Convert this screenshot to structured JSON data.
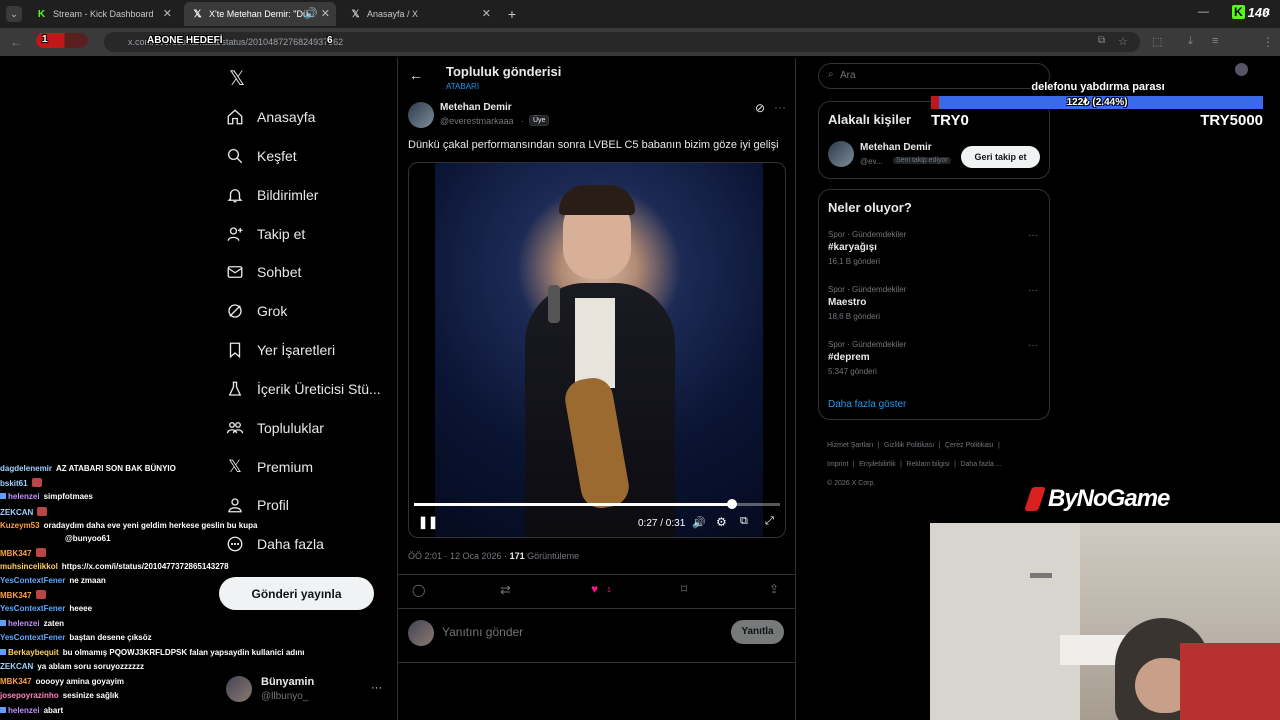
{
  "browser": {
    "tabs": [
      {
        "title": "Stream - Kick Dashboard",
        "active": false
      },
      {
        "title": "X'te Metehan Demir: \"Dünk",
        "active": true
      },
      {
        "title": "Anasayfa / X",
        "active": false
      }
    ],
    "url": "x.com/everestmarkaaa/status/2010487276824937562",
    "new_tab": "+"
  },
  "overlay": {
    "goal_count": "1",
    "goal_label": "ABONE HEDEFİ",
    "goal_target": "6",
    "kick_count": "140",
    "donation_title": "delefonu yabdırma parası",
    "donation_progress_text": "122₺ (2.44%)",
    "donation_progress": 0.0244,
    "donation_min": "TRY0",
    "donation_max": "TRY5000",
    "brand": "ByNoGame"
  },
  "x": {
    "nav": [
      {
        "label": "Anasayfa",
        "icon": "home-icon"
      },
      {
        "label": "Keşfet",
        "icon": "search-icon"
      },
      {
        "label": "Bildirimler",
        "icon": "bell-icon"
      },
      {
        "label": "Takip et",
        "icon": "person-add-icon"
      },
      {
        "label": "Sohbet",
        "icon": "mail-icon"
      },
      {
        "label": "Grok",
        "icon": "grok-icon"
      },
      {
        "label": "Yer İşaretleri",
        "icon": "bookmark-icon"
      },
      {
        "label": "İçerik Üreticisi Stü...",
        "icon": "flask-icon"
      },
      {
        "label": "Topluluklar",
        "icon": "communities-icon"
      },
      {
        "label": "Premium",
        "icon": "x-logo-icon"
      },
      {
        "label": "Profil",
        "icon": "person-icon"
      },
      {
        "label": "Daha fazla",
        "icon": "more-circle-icon"
      }
    ],
    "post_button": "Gönderi yayınla",
    "account": {
      "name": "Bünyamin",
      "handle": "@llbunyo_",
      "more": "···"
    },
    "header": {
      "title": "Topluluk gönderisi",
      "subtitle": "ATABARI"
    },
    "post": {
      "author": "Metehan Demir",
      "handle": "@everestmarkaaa",
      "sep": "·",
      "badge": "Üye",
      "text": "Dünkü çakal performansından sonra LVBEL C5 babanın bizim göze iyi gelişi",
      "video_time": "0:27 / 0:31",
      "video_progress": 0.87,
      "timestamp": "ÖÖ 2:01 · 12 Oca 2026 ·",
      "views_count": "171",
      "views_label": "Görüntüleme",
      "like_count": "1"
    },
    "reply": {
      "placeholder": "Yanıtını gönder",
      "button": "Yanıtla"
    },
    "search_placeholder": "Ara",
    "who_to_follow": {
      "title": "Alakalı kişiler",
      "name": "Metehan Demir",
      "handle": "@ev...",
      "badge": "Seni takip ediyor",
      "button": "Geri takip et"
    },
    "trends": {
      "title": "Neler oluyor?",
      "items": [
        {
          "category": "Spor · Gündemdekiler",
          "name": "#karyağışı",
          "count": "16,1 B gönderi"
        },
        {
          "category": "Spor · Gündemdekiler",
          "name": "Maestro",
          "count": "18,6 B gönderi"
        },
        {
          "category": "Spor · Gündemdekiler",
          "name": "#deprem",
          "count": "5.347 gönderi"
        }
      ],
      "more": "Daha fazla göster"
    },
    "footer": {
      "links": [
        "Hizmet Şartları",
        "Gizlilik Politikası",
        "Çerez Politikası",
        "Imprint",
        "Erişilebilirlik",
        "Reklam bilgisi",
        "Daha fazla ..."
      ],
      "copyright": "© 2026 X Corp."
    }
  },
  "chat": [
    {
      "user": "dagdelenemir",
      "msg": "AZ ATABARI SON BAK BÜNYIO",
      "color": "#9fd0ff"
    },
    {
      "user": "bskit61",
      "msg": "",
      "color": "#9fd0ff",
      "emote": true
    },
    {
      "user": "helenzei",
      "msg": "simpfotmaes",
      "color": "#c090ff",
      "badges": true
    },
    {
      "user": "ZEKCAN",
      "msg": "",
      "color": "#9fd0ff",
      "emote": true
    },
    {
      "user": "Kuzeym53",
      "msg": "oradaydım daha eve yeni geldim herkese geslin bu kupa",
      "color": "#ffa040"
    },
    {
      "user": "",
      "msg": "@bunyoo61",
      "color": "#ffffff"
    },
    {
      "user": "MBK347",
      "msg": "",
      "color": "#ffa040",
      "emote": true
    },
    {
      "user": "muhsincelikkol",
      "msg": "https://x.com/i/status/2010477372865143278",
      "color": "#ffd060"
    },
    {
      "user": "YesContextFener",
      "msg": "ne zmaan",
      "color": "#5fa8ff"
    },
    {
      "user": "MBK347",
      "msg": "",
      "color": "#ffa040",
      "emote": true
    },
    {
      "user": "YesContextFener",
      "msg": "heeee",
      "color": "#5fa8ff"
    },
    {
      "user": "helenzei",
      "msg": "zaten",
      "color": "#c090ff",
      "badges": true
    },
    {
      "user": "YesContextFener",
      "msg": "baştan desene çıksöz",
      "color": "#5fa8ff"
    },
    {
      "user": "Berkaybequit",
      "msg": "bu olmamış PQOWJ3KRFLDPSK falan yapsaydin kullanici adını",
      "color": "#ffd060",
      "badges": true
    },
    {
      "user": "ZEKCAN",
      "msg": "ya ablam soru soruyozzzzzz",
      "color": "#9fd0ff"
    },
    {
      "user": "MBK347",
      "msg": "ooooyy amina goyayim",
      "color": "#ffa040"
    },
    {
      "user": "josepoyrazinho",
      "msg": "sesinize sağlık",
      "color": "#ff80c0"
    },
    {
      "user": "helenzei",
      "msg": "abart",
      "color": "#c090ff",
      "badges": true
    }
  ]
}
